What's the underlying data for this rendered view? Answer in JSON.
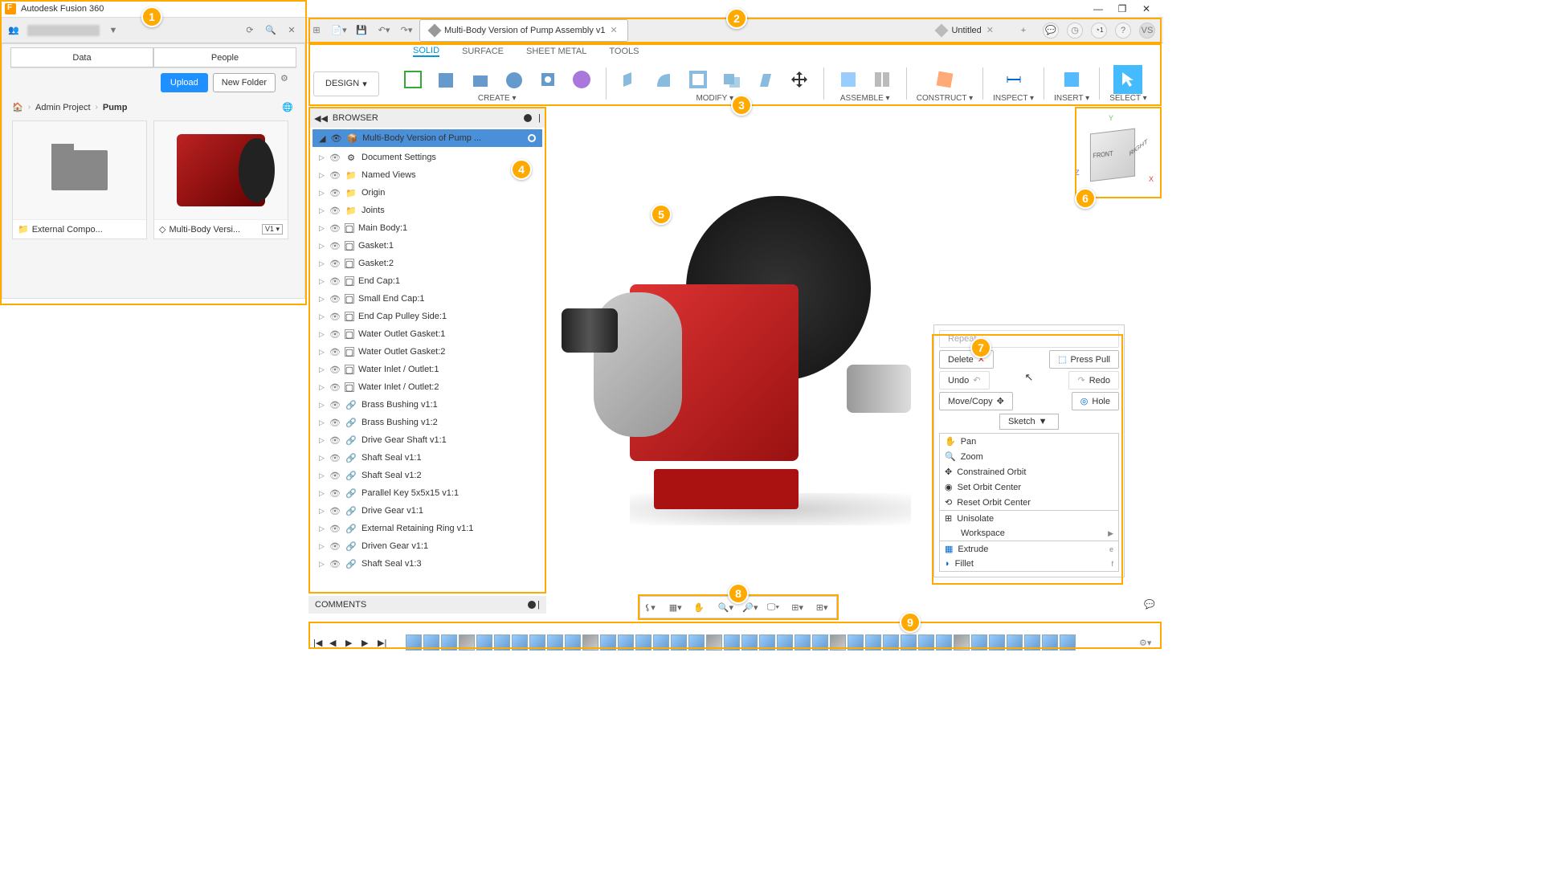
{
  "window": {
    "title": "Autodesk Fusion 360"
  },
  "topbar": {
    "tabs": [
      {
        "label": "Multi-Body Version of Pump Assembly v1"
      },
      {
        "label": "Untitled"
      }
    ],
    "right_icons": {
      "clock_badge": "1",
      "avatar": "VS"
    }
  },
  "sidebar": {
    "tabs": {
      "data": "Data",
      "people": "People"
    },
    "upload": "Upload",
    "new_folder": "New Folder",
    "breadcrumb": {
      "l1": "Admin Project",
      "l2": "Pump"
    },
    "thumbs": [
      {
        "label": "External Compo..."
      },
      {
        "label": "Multi-Body Versi...",
        "version": "V1 ▾"
      }
    ]
  },
  "toolbar": {
    "design": "DESIGN",
    "tabs": {
      "solid": "SOLID",
      "surface": "SURFACE",
      "sheet": "SHEET METAL",
      "tools": "TOOLS"
    },
    "groups": {
      "create": "CREATE ▾",
      "modify": "MODIFY ▾",
      "assemble": "ASSEMBLE ▾",
      "construct": "CONSTRUCT ▾",
      "inspect": "INSPECT ▾",
      "insert": "INSERT ▾",
      "select": "SELECT ▾"
    }
  },
  "browser": {
    "title": "BROWSER",
    "root": "Multi-Body Version of Pump ...",
    "items": [
      {
        "icon": "gear",
        "label": "Document Settings"
      },
      {
        "icon": "folder",
        "label": "Named Views"
      },
      {
        "icon": "folder",
        "label": "Origin"
      },
      {
        "icon": "folder",
        "label": "Joints"
      },
      {
        "icon": "body",
        "label": "Main Body:1"
      },
      {
        "icon": "body",
        "label": "Gasket:1"
      },
      {
        "icon": "body",
        "label": "Gasket:2"
      },
      {
        "icon": "body",
        "label": "End Cap:1"
      },
      {
        "icon": "body",
        "label": "Small End Cap:1"
      },
      {
        "icon": "body",
        "label": "End Cap Pulley Side:1"
      },
      {
        "icon": "body",
        "label": "Water Outlet Gasket:1"
      },
      {
        "icon": "body",
        "label": "Water Outlet Gasket:2"
      },
      {
        "icon": "body",
        "label": "Water Inlet / Outlet:1"
      },
      {
        "icon": "body",
        "label": "Water Inlet / Outlet:2"
      },
      {
        "icon": "link",
        "label": "Brass Bushing v1:1"
      },
      {
        "icon": "link",
        "label": "Brass Bushing v1:2"
      },
      {
        "icon": "link",
        "label": "Drive Gear Shaft v1:1"
      },
      {
        "icon": "link",
        "label": "Shaft Seal v1:1"
      },
      {
        "icon": "link",
        "label": "Shaft Seal v1:2"
      },
      {
        "icon": "link",
        "label": "Parallel Key 5x5x15 v1:1"
      },
      {
        "icon": "link",
        "label": "Drive Gear v1:1"
      },
      {
        "icon": "link",
        "label": "External Retaining Ring v1:1"
      },
      {
        "icon": "link",
        "label": "Driven Gear v1:1"
      },
      {
        "icon": "link",
        "label": "Shaft Seal v1:3"
      }
    ]
  },
  "marking": {
    "repeat": "Repeat...",
    "delete": "Delete",
    "press_pull": "Press Pull",
    "undo": "Undo",
    "redo": "Redo",
    "move_copy": "Move/Copy",
    "hole": "Hole",
    "sketch": "Sketch",
    "nav": {
      "pan": "Pan",
      "zoom": "Zoom",
      "constrained": "Constrained Orbit",
      "set_center": "Set Orbit Center",
      "reset_center": "Reset Orbit Center"
    },
    "misc": {
      "unisolate": "Unisolate",
      "workspace": "Workspace",
      "extrude": "Extrude",
      "fillet": "Fillet"
    },
    "keys": {
      "extrude": "e",
      "fillet": "f"
    }
  },
  "comments": {
    "title": "COMMENTS"
  },
  "callouts": [
    "1",
    "2",
    "3",
    "4",
    "5",
    "6",
    "7",
    "8",
    "9"
  ]
}
